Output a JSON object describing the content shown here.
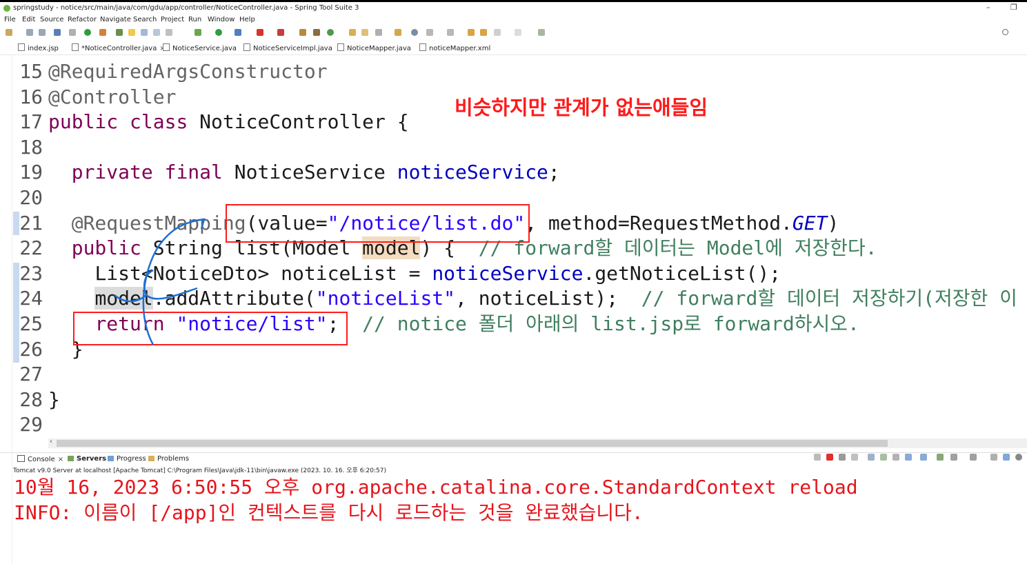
{
  "window": {
    "title": "springstudy - notice/src/main/java/com/gdu/app/controller/NoticeController.java - Spring Tool Suite 3",
    "minimize": "–",
    "restore": "❐"
  },
  "menu": [
    "File",
    "Edit",
    "Source",
    "Refactor",
    "Navigate",
    "Search",
    "Project",
    "Run",
    "Window",
    "Help"
  ],
  "tabs": [
    {
      "label": "index.jsp"
    },
    {
      "label": "*NoticeController.java",
      "active": true,
      "close": "×"
    },
    {
      "label": "NoticeService.java"
    },
    {
      "label": "NoticeServiceImpl.java"
    },
    {
      "label": "NoticeMapper.java"
    },
    {
      "label": "noticeMapper.xml"
    }
  ],
  "editor": {
    "lines": [
      {
        "n": "15",
        "code": "@RequiredArgsConstructor"
      },
      {
        "n": "16",
        "code": "@Controller"
      },
      {
        "n": "17",
        "code": "public class NoticeController {"
      },
      {
        "n": "18",
        "code": ""
      },
      {
        "n": "19",
        "code": "  private final NoticeService noticeService;"
      },
      {
        "n": "20",
        "code": ""
      },
      {
        "n": "21",
        "code": "  @RequestMapping(value=\"/notice/list.do\", method=RequestMethod.GET)"
      },
      {
        "n": "22",
        "code": "  public String list(Model model) {  // forward할 데이터는 Model에 저장한다."
      },
      {
        "n": "23",
        "code": "    List<NoticeDto> noticeList = noticeService.getNoticeList();"
      },
      {
        "n": "24",
        "code": "    model.addAttribute(\"noticeList\", noticeList);  // forward할 데이터 저장하기(저장한 이"
      },
      {
        "n": "25",
        "code": "    return \"notice/list\";  // notice 폴더 아래의 list.jsp로 forward하시오."
      },
      {
        "n": "26",
        "code": "  }"
      },
      {
        "n": "27",
        "code": ""
      },
      {
        "n": "28",
        "code": "}"
      },
      {
        "n": "29",
        "code": ""
      }
    ],
    "tokens": {
      "ann1": "@RequiredArgsConstructor",
      "ann2": "@Controller",
      "kw_public": "public",
      "kw_class": "class",
      "cls_name": "NoticeController {",
      "kw_private": "private",
      "kw_final": "final",
      "svc_type": "NoticeService",
      "svc_field": "noticeService",
      "semi": ";",
      "ann3": "@RequestMapping",
      "l21_a": "(value=",
      "l21_str": "\"/notice/list.do\"",
      "l21_b": ", method=RequestMethod.",
      "l21_get": "GET",
      "l21_c": ")",
      "l22_type": "String list(Model ",
      "l22_model": "model",
      "l22_b": ") {  ",
      "l22_cmt": "// forward할 데이터는 Model에 저장한다.",
      "l23_a": "List<NoticeDto> noticeList = ",
      "l23_fld": "noticeService",
      "l23_b": ".getNoticeList();",
      "l24_model": "model",
      "l24_a": ".addAttribute(",
      "l24_str": "\"noticeList\"",
      "l24_b": ", noticeList);  ",
      "l24_cmt": "// forward할 데이터 저장하기(저장한 이",
      "kw_return": "return",
      "l25_str": "\"notice/list\"",
      "l25_b": ";  ",
      "l25_cmt": "// notice 폴더 아래의 list.jsp로 forward하시오.",
      "brace_close_inner": "}",
      "brace_close_outer": "}"
    }
  },
  "annotation": {
    "note": "비슷하지만 관계가 없는애들임",
    "color": "#ff1a1a"
  },
  "console_tabs": [
    {
      "label": "Console",
      "close": "×"
    },
    {
      "label": "Servers"
    },
    {
      "label": "Progress"
    },
    {
      "label": "Problems"
    }
  ],
  "server_line": "Tomcat v9.0 Server at localhost [Apache Tomcat] C:\\Program Files\\Java\\jdk-11\\bin\\javaw.exe  (2023. 10. 16. 오후 6:20:57)",
  "console_output": [
    "10월 16, 2023 6:50:55 오후 org.apache.catalina.core.StandardContext reload",
    "INFO: 이름이 [/app]인 컨텍스트를 다시 로드하는 것을 완료했습니다."
  ],
  "colors": {
    "keyword": "#7f0055",
    "string": "#2a00ff",
    "comment": "#3f7f5f",
    "field": "#0000c0",
    "annotation": "#646464",
    "console_error": "#e5141c"
  }
}
